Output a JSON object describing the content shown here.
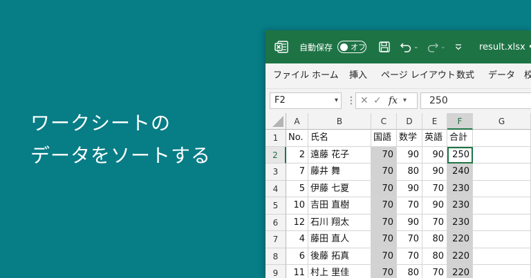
{
  "headline": [
    "ワークシートの",
    "データをソートする"
  ],
  "titlebar": {
    "autosave_label": "自動保存",
    "autosave_state": "オフ",
    "filename": "result.xlsx •"
  },
  "ribbon_tabs": [
    "ファイル",
    "ホーム",
    "挿入",
    "ページ レイアウト",
    "数式",
    "データ",
    "校"
  ],
  "formula_bar": {
    "name_box": "F2",
    "fx": "fx",
    "value": "250"
  },
  "columns": [
    "A",
    "B",
    "C",
    "D",
    "E",
    "F",
    "G"
  ],
  "selected_column": "F",
  "rows": [
    "1",
    "2",
    "3",
    "4",
    "5",
    "6",
    "7",
    "8",
    "9"
  ],
  "selected_row": "2",
  "header_row": [
    "No.",
    "氏名",
    "国語",
    "数学",
    "英語",
    "合計"
  ],
  "data_rows": [
    [
      "2",
      "遠藤 花子",
      "70",
      "90",
      "90",
      "250"
    ],
    [
      "7",
      "藤井 舞",
      "70",
      "80",
      "90",
      "240"
    ],
    [
      "5",
      "伊藤 七夏",
      "70",
      "90",
      "70",
      "230"
    ],
    [
      "10",
      "吉田 直樹",
      "70",
      "70",
      "90",
      "230"
    ],
    [
      "12",
      "石川 翔太",
      "70",
      "90",
      "70",
      "230"
    ],
    [
      "4",
      "藤田 直人",
      "70",
      "70",
      "80",
      "220"
    ],
    [
      "6",
      "後藤 拓真",
      "70",
      "70",
      "80",
      "220"
    ],
    [
      "11",
      "村上 里佳",
      "70",
      "80",
      "70",
      "220"
    ]
  ],
  "colors": {
    "background": "#077d86",
    "excel_green": "#1e7345",
    "sort_shade": "#d2d2d2"
  }
}
